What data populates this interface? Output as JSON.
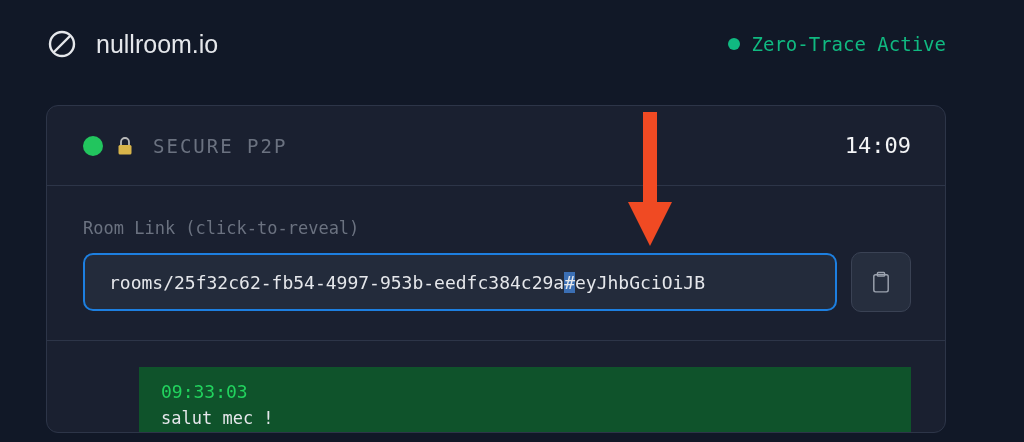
{
  "header": {
    "brand": "nullroom.io",
    "status": {
      "label": "Zero-Trace Active",
      "color": "#10b981"
    }
  },
  "card": {
    "connection": {
      "label": "SECURE P2P",
      "color": "#22c55e"
    },
    "time": "14:09",
    "room_link": {
      "label": "Room Link (click-to-reveal)",
      "value_before": "rooms/25f32c62-fb54-4997-953b-eedfc384c29a",
      "value_selected": "#",
      "value_after": "eyJhbGciOiJB"
    },
    "messages": [
      {
        "time": "09:33:03",
        "text": "salut mec !"
      }
    ]
  }
}
